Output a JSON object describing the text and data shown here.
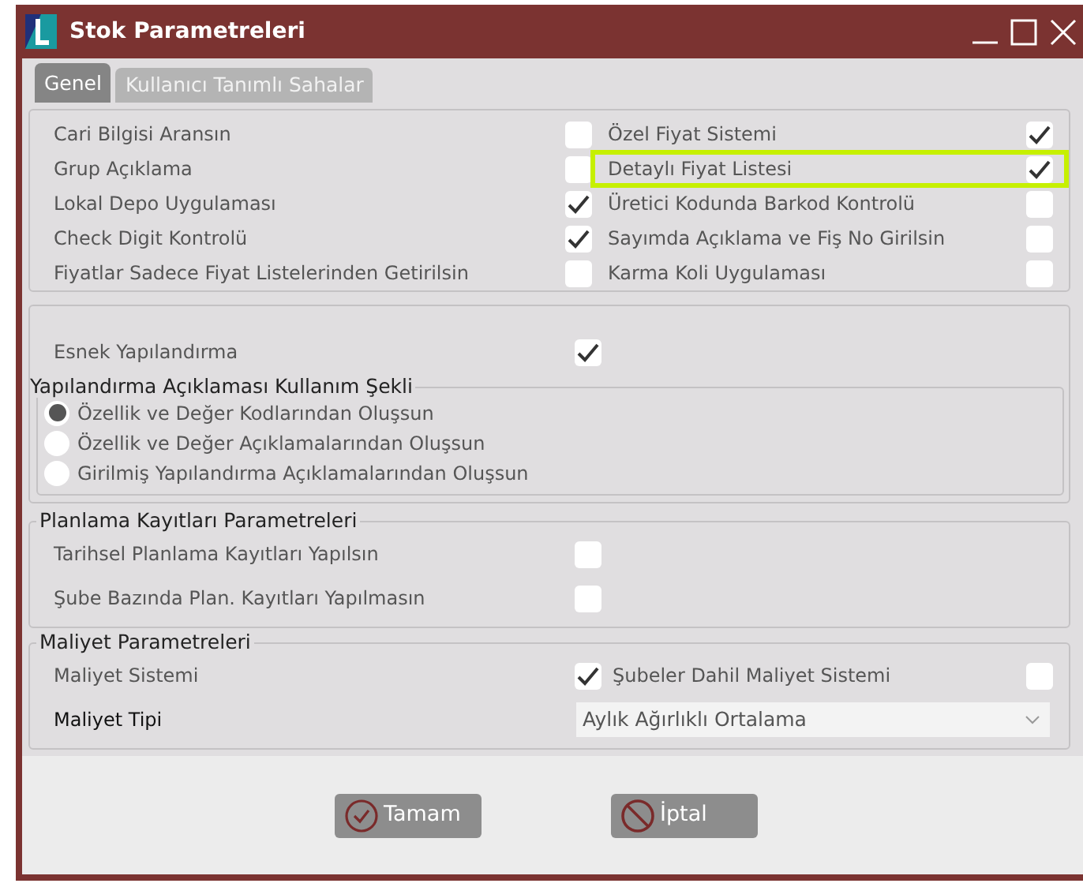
{
  "window": {
    "title": "Stok Parametreleri"
  },
  "tabs": [
    {
      "label": "Genel",
      "selected": true
    },
    {
      "label": "Kullanıcı Tanımlı Sahalar",
      "selected": false
    }
  ],
  "general_options": [
    {
      "label": "Cari Bilgisi Aransın",
      "checked": false,
      "highlighted": false
    },
    {
      "label": "Özel Fiyat Sistemi",
      "checked": true,
      "highlighted": false
    },
    {
      "label": "Grup Açıklama",
      "checked": false,
      "highlighted": false
    },
    {
      "label": "Detaylı Fiyat Listesi",
      "checked": true,
      "highlighted": true
    },
    {
      "label": "Lokal Depo Uygulaması",
      "checked": true,
      "highlighted": false
    },
    {
      "label": "Üretici Kodunda Barkod Kontrolü",
      "checked": false,
      "highlighted": false
    },
    {
      "label": "Check Digit Kontrolü",
      "checked": true,
      "highlighted": false
    },
    {
      "label": "Sayımda Açıklama ve Fiş No Girilsin",
      "checked": false,
      "highlighted": false
    },
    {
      "label": "Fiyatlar Sadece Fiyat Listelerinden Getirilsin",
      "checked": false,
      "highlighted": false
    },
    {
      "label": "Karma Koli Uygulaması",
      "checked": false,
      "highlighted": false
    }
  ],
  "flexible_config": {
    "label": "Esnek Yapılandırma",
    "checked": true
  },
  "config_description": {
    "legend": "Yapılandırma Açıklaması Kullanım Şekli",
    "options": [
      {
        "label": "Özellik ve Değer Kodlarından Oluşsun",
        "selected": true
      },
      {
        "label": "Özellik ve Değer Açıklamalarından Oluşsun",
        "selected": false
      },
      {
        "label": "Girilmiş Yapılandırma Açıklamalarından Oluşsun",
        "selected": false
      }
    ]
  },
  "planning": {
    "legend": "Planlama Kayıtları Parametreleri",
    "options": [
      {
        "label": "Tarihsel Planlama Kayıtları Yapılsın",
        "checked": false
      },
      {
        "label": "Şube Bazında Plan. Kayıtları Yapılmasın",
        "checked": false
      }
    ]
  },
  "cost": {
    "legend": "Maliyet Parametreleri",
    "options": [
      {
        "label": "Maliyet Sistemi",
        "checked": true
      },
      {
        "label": "Şubeler Dahil Maliyet Sistemi",
        "checked": false
      }
    ],
    "cost_type": {
      "label": "Maliyet Tipi",
      "value": "Aylık Ağırlıklı Ortalama"
    }
  },
  "buttons": [
    {
      "label": "Tamam",
      "kind": "ok"
    },
    {
      "label": "İptal",
      "kind": "cancel"
    }
  ]
}
